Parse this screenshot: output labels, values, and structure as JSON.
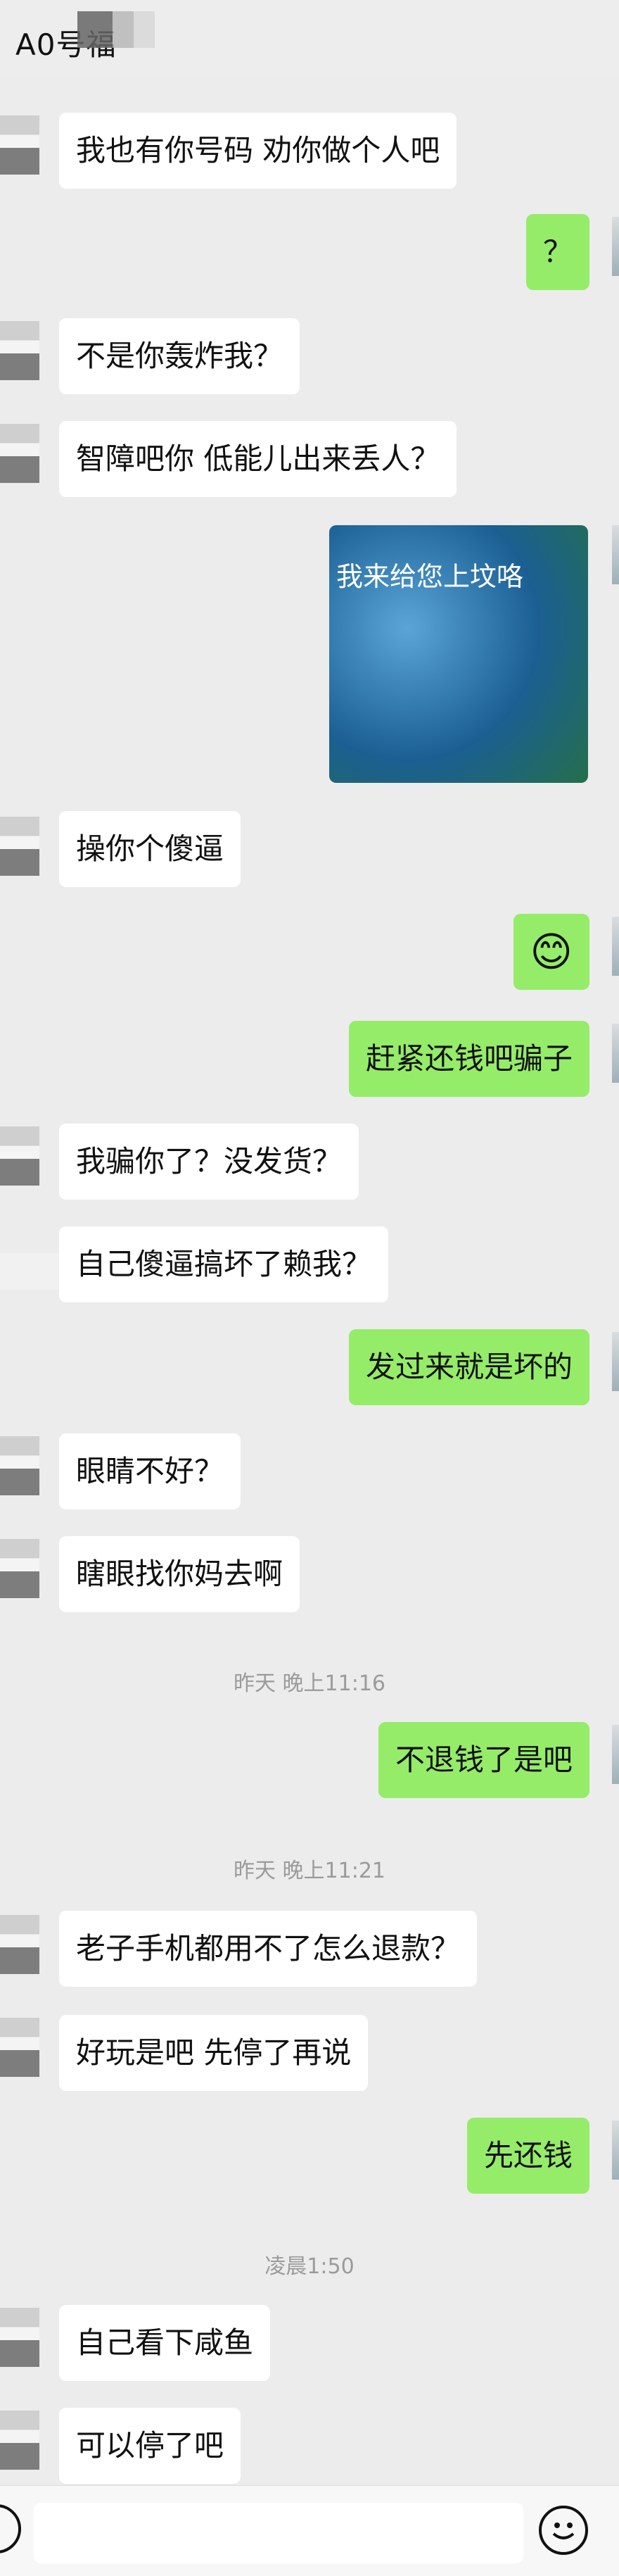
{
  "header": {
    "title": "A0号福"
  },
  "messages": [
    {
      "side": "left",
      "text": "我也有你号码 劝你做个人吧"
    },
    {
      "side": "right",
      "text": "？"
    },
    {
      "side": "left",
      "text": "不是你轰炸我？"
    },
    {
      "side": "left",
      "text": "智障吧你 低能儿出来丢人？"
    },
    {
      "side": "right",
      "sticker_text": "我来给您上坟咯"
    },
    {
      "side": "left",
      "text": "操你个傻逼"
    },
    {
      "side": "right",
      "text": "😊"
    },
    {
      "side": "right",
      "text": "赶紧还钱吧骗子"
    },
    {
      "side": "left",
      "text": "我骗你了？没发货？"
    },
    {
      "side": "left",
      "text": "自己傻逼搞坏了赖我？"
    },
    {
      "side": "right",
      "text": "发过来就是坏的"
    },
    {
      "side": "left",
      "text": "眼睛不好？"
    },
    {
      "side": "left",
      "text": "瞎眼找你妈去啊"
    },
    {
      "time": "昨天 晚上11:16"
    },
    {
      "side": "right",
      "text": "不退钱了是吧"
    },
    {
      "time": "昨天 晚上11:21"
    },
    {
      "side": "left",
      "text": "老子手机都用不了怎么退款？"
    },
    {
      "side": "left",
      "text": "好玩是吧 先停了再说"
    },
    {
      "side": "right",
      "text": "先还钱"
    },
    {
      "time": "凌晨1:50"
    },
    {
      "side": "left",
      "text": "自己看下咸鱼"
    },
    {
      "side": "left",
      "text": "可以停了吧"
    }
  ],
  "icons": [
    "voice-icon",
    "emoji-icon"
  ]
}
